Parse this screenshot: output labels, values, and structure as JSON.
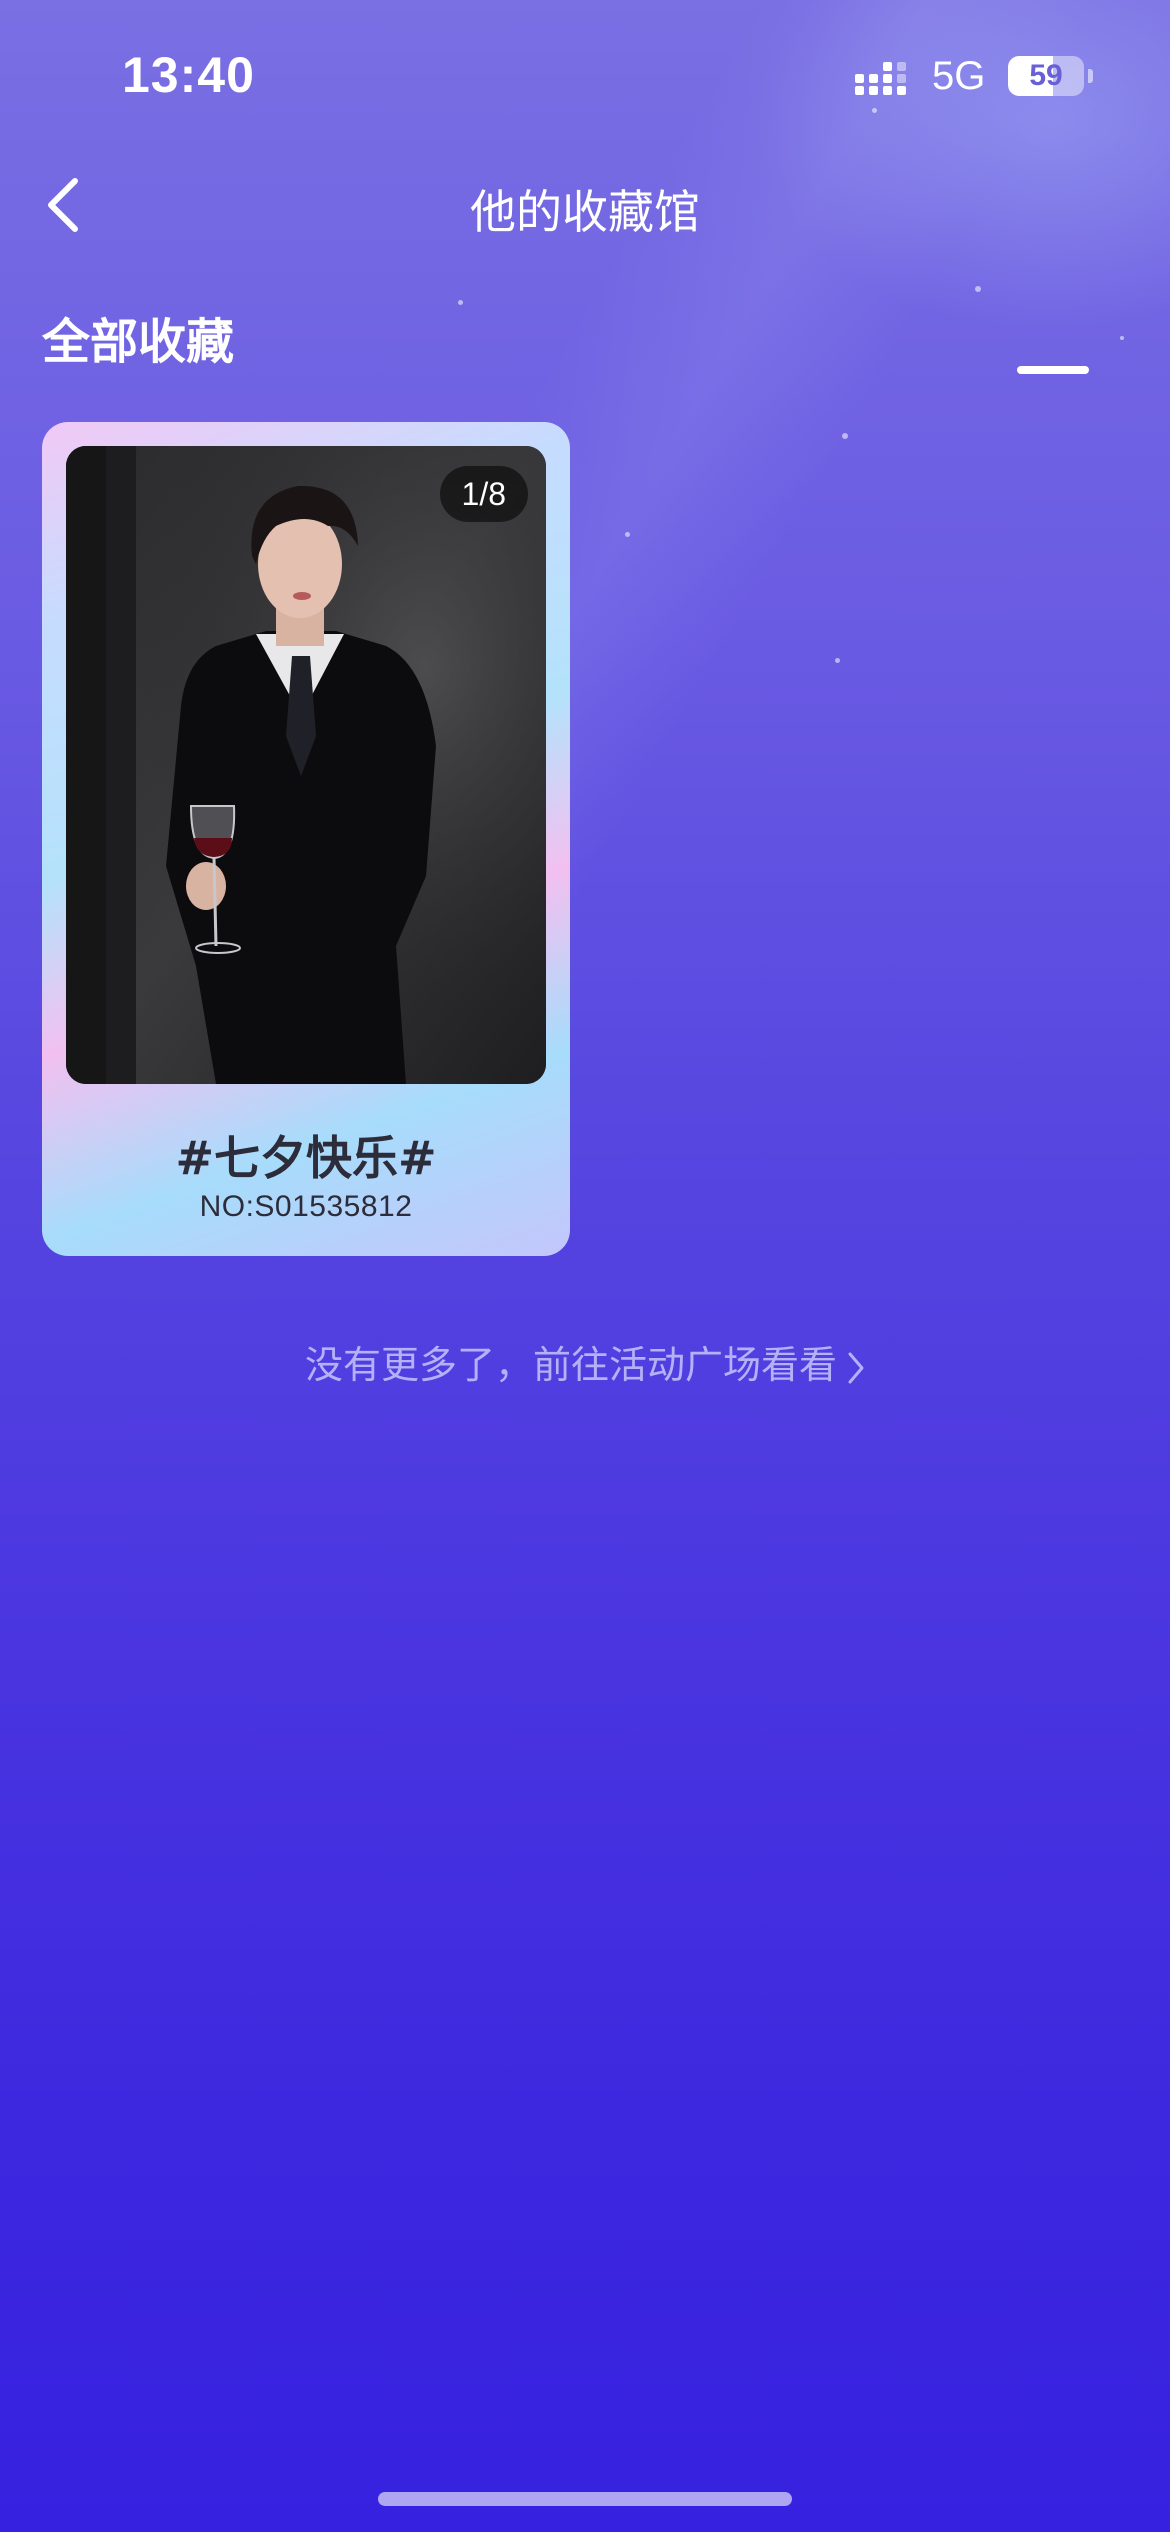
{
  "status_bar": {
    "time": "13:40",
    "network": "5G",
    "battery_level": "59",
    "battery_fraction": 0.59,
    "signal_icon": "signal-bars-icon"
  },
  "nav": {
    "back_icon": "chevron-left-icon",
    "title": "他的收藏馆"
  },
  "section": {
    "title": "全部收藏"
  },
  "collection": [
    {
      "page_count": "1/8",
      "title": "#七夕快乐#",
      "serial": "NO:S01535812"
    }
  ],
  "footer": {
    "more_text": "没有更多了，前往活动广场看看",
    "more_icon": "chevron-right-icon"
  },
  "colors": {
    "background_top": "#7a6fe3",
    "background_bottom": "#3621e0",
    "card_text": "#2c2c3a"
  }
}
